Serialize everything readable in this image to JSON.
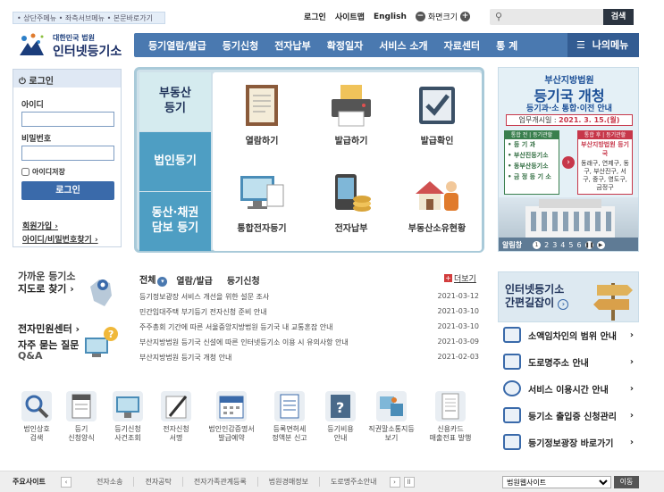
{
  "skip_nav": "• 상단주메뉴 • 좌측서브메뉴 • 본문바로가기",
  "top_links": {
    "login": "로그인",
    "sitemap": "사이트맵",
    "english": "English",
    "zoom": "화면크기"
  },
  "search": {
    "placeholder": "",
    "button": "검색"
  },
  "logo": {
    "sub": "대한민국 법원",
    "main": "인터넷등기소"
  },
  "nav": [
    "등기열람/발급",
    "등기신청",
    "전자납부",
    "확정일자",
    "서비스 소개",
    "자료센터",
    "통 계"
  ],
  "nav_my": "나의메뉴",
  "login_box": {
    "title": "로그인",
    "id_label": "아이디",
    "pw_label": "비밀번호",
    "save_id": "아이디저장",
    "button": "로그인",
    "join": "회원가입 ›",
    "find": "아이디/비밀번호찾기 ›"
  },
  "categories": [
    "부동산\n등기",
    "법인등기",
    "동산·채권\n담보 등기"
  ],
  "services": [
    "열람하기",
    "발급하기",
    "발급확인",
    "통합전자등기",
    "전자납부",
    "부동산소유현황"
  ],
  "banner": {
    "org": "부산지방법원",
    "title": "등기국 개청",
    "subtitle": "등기과·소 통합·이전 안내",
    "date_label": "업무개시일 :",
    "date": "2021. 3. 15.(월)",
    "left_head": "통합 전 | 등기관할",
    "left_items": [
      "• 등 기 과",
      "• 부산진등기소",
      "• 동부산등기소",
      "• 금 정 등 기 소"
    ],
    "right_head": "통합 후 | 등기관할",
    "right_title": "부산지방법원 등기국",
    "right_items": "동래구, 연제구, 동구, 부산진구, 서구, 중구, 영도구, 금정구",
    "control_label": "알림창",
    "pages": [
      "1",
      "2",
      "3",
      "4",
      "5",
      "6"
    ]
  },
  "near_office": {
    "line1": "가까운 등기소",
    "line2": "지도로 찾기 ›"
  },
  "civil": {
    "line1": "전자민원센터 ›",
    "line2": "자주 묻는 질문",
    "line3": "Q&A"
  },
  "news_tabs": {
    "all": "전체",
    "view": "열람/발급",
    "apply": "등기신청"
  },
  "news_more": "더보기",
  "news": [
    {
      "title": "등기정보광장 서비스 개선을 위한 설문 조사",
      "date": "2021-03-12"
    },
    {
      "title": "민간임대주택 부기등기 전자신청 준비 안내",
      "date": "2021-03-10"
    },
    {
      "title": "주주총회 기간에 따른 서울중앙지방법원 등기국 내 교통혼잡 안내",
      "date": "2021-03-10"
    },
    {
      "title": "부산지방법원 등기국 신설에 따른 인터넷등기소 이용 시 유의사항 안내",
      "date": "2021-03-09"
    },
    {
      "title": "부산지방법원 등기국 개청 안내",
      "date": "2021-02-03"
    }
  ],
  "guide": {
    "line1": "인터넷등기소",
    "line2": "간편길잡이"
  },
  "right_links": [
    {
      "label": "소액임차인의 범위 안내",
      "icon": "house-icon"
    },
    {
      "label": "도로명주소 안내",
      "icon": "address-sign-icon"
    },
    {
      "label": "서비스 이용시간 안내",
      "icon": "clock-icon"
    },
    {
      "label": "등기소 출입증 신청관리",
      "icon": "id-card-icon"
    },
    {
      "label": "등기정보광장 바로가기",
      "icon": "chart-icon"
    }
  ],
  "bottom_icons": [
    {
      "l1": "법인상호",
      "l2": "검색",
      "icon": "magnifier-icon"
    },
    {
      "l1": "등기",
      "l2": "신청양식",
      "icon": "form-icon"
    },
    {
      "l1": "등기신청",
      "l2": "사건조회",
      "icon": "monitor-icon"
    },
    {
      "l1": "전자신청",
      "l2": "서명",
      "icon": "pen-icon"
    },
    {
      "l1": "법인인감증명서",
      "l2": "발급예약",
      "icon": "calendar-icon"
    },
    {
      "l1": "등록면허세",
      "l2": "정액분 신고",
      "icon": "document-icon"
    },
    {
      "l1": "등기비용",
      "l2": "안내",
      "icon": "question-book-icon"
    },
    {
      "l1": "직권말소통지등",
      "l2": "보기",
      "icon": "puzzle-icon"
    },
    {
      "l1": "신용카드",
      "l2": "매출전표 발행",
      "icon": "receipt-icon"
    }
  ],
  "footer": {
    "label": "주요사이트",
    "items": [
      "전자소송",
      "전자공탁",
      "전자가족관계등록",
      "법원경매정보",
      "도로명주소안내"
    ],
    "select": "법원웹사이트",
    "go": "이동"
  }
}
